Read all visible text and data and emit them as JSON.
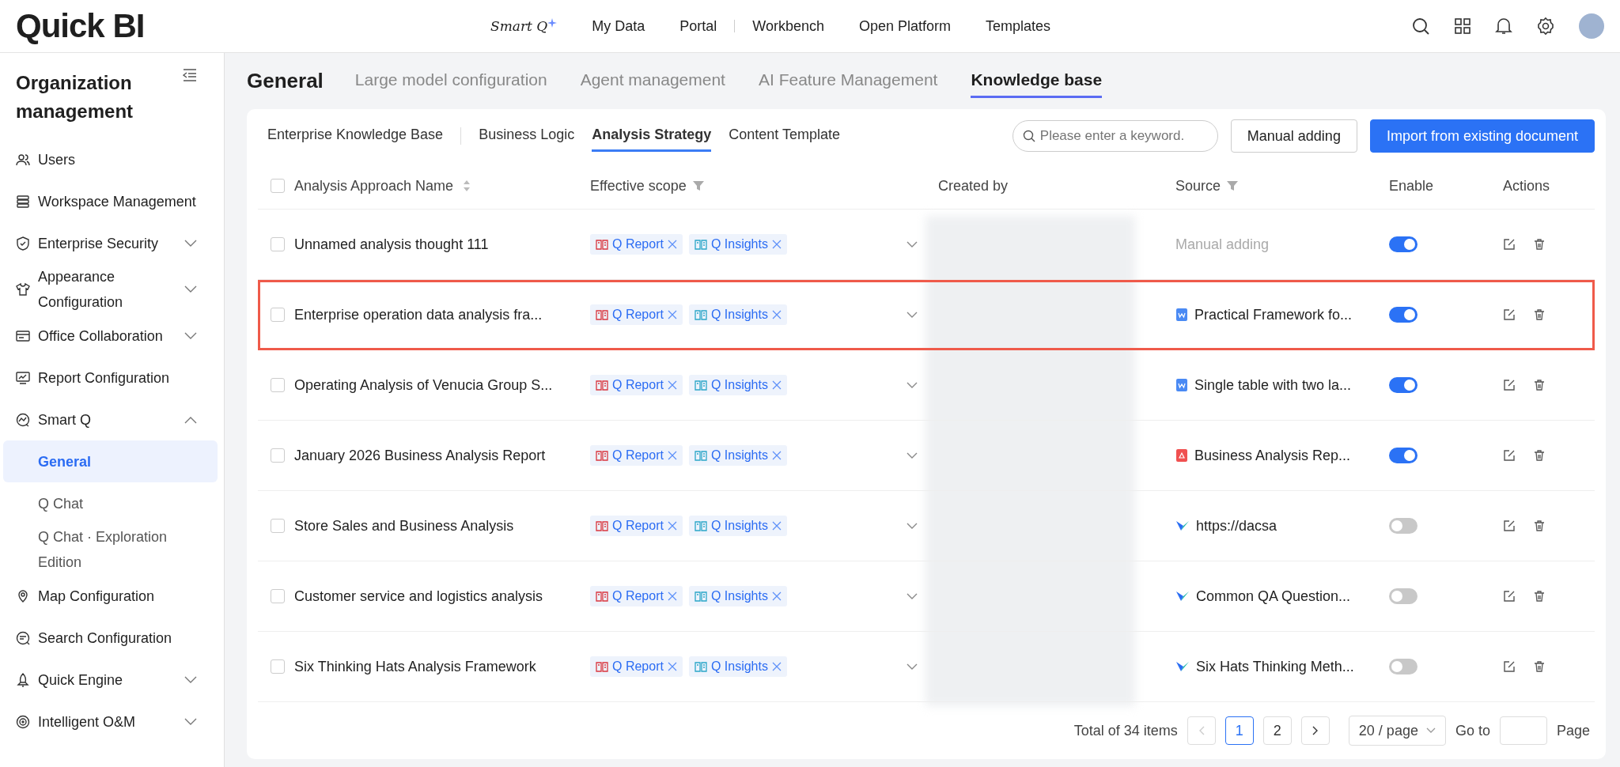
{
  "header": {
    "logo": "Quick BI",
    "smart_q": "Smart Q",
    "nav_groups": [
      [
        "My Data",
        "Portal"
      ],
      [
        "Workbench",
        "Open Platform",
        "Templates"
      ]
    ]
  },
  "sidebar": {
    "title": "Organization management",
    "items": [
      {
        "label": "Users",
        "kind": "users"
      },
      {
        "label": "Workspace Management",
        "kind": "workspace"
      },
      {
        "label": "Enterprise Security",
        "kind": "security",
        "expanded": false
      },
      {
        "label": "Appearance Configuration",
        "kind": "appearance",
        "expanded": false
      },
      {
        "label": "Office Collaboration",
        "kind": "office",
        "expanded": false
      },
      {
        "label": "Report Configuration",
        "kind": "report"
      },
      {
        "label": "Smart Q",
        "kind": "smartq",
        "expanded": true,
        "children": [
          {
            "label": "General",
            "selected": true
          },
          {
            "label": "Q Chat",
            "selected": false
          },
          {
            "label": "Q Chat · Exploration Edition",
            "selected": false
          }
        ]
      },
      {
        "label": "Map Configuration",
        "kind": "map"
      },
      {
        "label": "Search Configuration",
        "kind": "search"
      },
      {
        "label": "Quick Engine",
        "kind": "engine",
        "expanded": false
      },
      {
        "label": "Intelligent O&M",
        "kind": "om",
        "expanded": false
      }
    ]
  },
  "page_title": "General",
  "page_tabs": [
    {
      "label": "Large model configuration",
      "selected": false
    },
    {
      "label": "Agent management",
      "selected": false
    },
    {
      "label": "AI Feature Management",
      "selected": false
    },
    {
      "label": "Knowledge base",
      "selected": true
    }
  ],
  "sub_tabs": [
    {
      "label": "Enterprise Knowledge Base",
      "selected": false
    },
    {
      "label": "Business Logic",
      "selected": false
    },
    {
      "label": "Analysis Strategy",
      "selected": true
    },
    {
      "label": "Content Template",
      "selected": false
    }
  ],
  "search": {
    "placeholder": "Please enter a keyword."
  },
  "buttons": {
    "manual": "Manual adding",
    "import": "Import from existing document"
  },
  "table": {
    "select_all_checked": false,
    "columns": [
      {
        "label": "Analysis Approach Name",
        "kind": "sortable"
      },
      {
        "label": "Effective scope",
        "kind": "filterable"
      },
      {
        "label": "Created by",
        "kind": "plain"
      },
      {
        "label": "Source",
        "kind": "filterable"
      },
      {
        "label": "Enable",
        "kind": "plain"
      },
      {
        "label": "Actions",
        "kind": "plain"
      }
    ],
    "rows": [
      {
        "name": "Unnamed analysis thought 111",
        "checked": false,
        "highlighted": false,
        "scope": [
          {
            "label": "Q Report",
            "kind": "report"
          },
          {
            "label": "Q Insights",
            "kind": "insights"
          }
        ],
        "source": {
          "label": "Manual adding",
          "kind": "manual"
        },
        "enabled": true
      },
      {
        "name": "Enterprise operation data analysis fra...",
        "checked": false,
        "highlighted": true,
        "scope": [
          {
            "label": "Q Report",
            "kind": "report"
          },
          {
            "label": "Q Insights",
            "kind": "insights"
          }
        ],
        "source": {
          "label": "Practical Framework fo...",
          "kind": "word"
        },
        "enabled": true
      },
      {
        "name": "Operating Analysis of Venucia Group S...",
        "checked": false,
        "highlighted": false,
        "scope": [
          {
            "label": "Q Report",
            "kind": "report"
          },
          {
            "label": "Q Insights",
            "kind": "insights"
          }
        ],
        "source": {
          "label": "Single table with two la...",
          "kind": "word"
        },
        "enabled": true
      },
      {
        "name": "January 2026 Business Analysis Report",
        "checked": false,
        "highlighted": false,
        "scope": [
          {
            "label": "Q Report",
            "kind": "report"
          },
          {
            "label": "Q Insights",
            "kind": "insights"
          }
        ],
        "source": {
          "label": "Business Analysis Rep...",
          "kind": "pdf"
        },
        "enabled": true
      },
      {
        "name": "Store Sales and Business Analysis",
        "checked": false,
        "highlighted": false,
        "scope": [
          {
            "label": "Q Report",
            "kind": "report"
          },
          {
            "label": "Q Insights",
            "kind": "insights"
          }
        ],
        "source": {
          "label": "https://dacsa",
          "kind": "link"
        },
        "enabled": false
      },
      {
        "name": "Customer service and logistics analysis",
        "checked": false,
        "highlighted": false,
        "scope": [
          {
            "label": "Q Report",
            "kind": "report"
          },
          {
            "label": "Q Insights",
            "kind": "insights"
          }
        ],
        "source": {
          "label": "Common QA Question...",
          "kind": "link"
        },
        "enabled": false
      },
      {
        "name": "Six Thinking Hats Analysis Framework",
        "checked": false,
        "highlighted": false,
        "scope": [
          {
            "label": "Q Report",
            "kind": "report"
          },
          {
            "label": "Q Insights",
            "kind": "insights"
          }
        ],
        "source": {
          "label": "Six Hats Thinking Meth...",
          "kind": "link"
        },
        "enabled": false
      }
    ]
  },
  "pagination": {
    "total": "Total of 34 items",
    "pages": [
      {
        "label": "1",
        "selected": true
      },
      {
        "label": "2",
        "selected": false
      }
    ],
    "page_size": "20 / page",
    "goto": "Go to",
    "page": "Page"
  }
}
